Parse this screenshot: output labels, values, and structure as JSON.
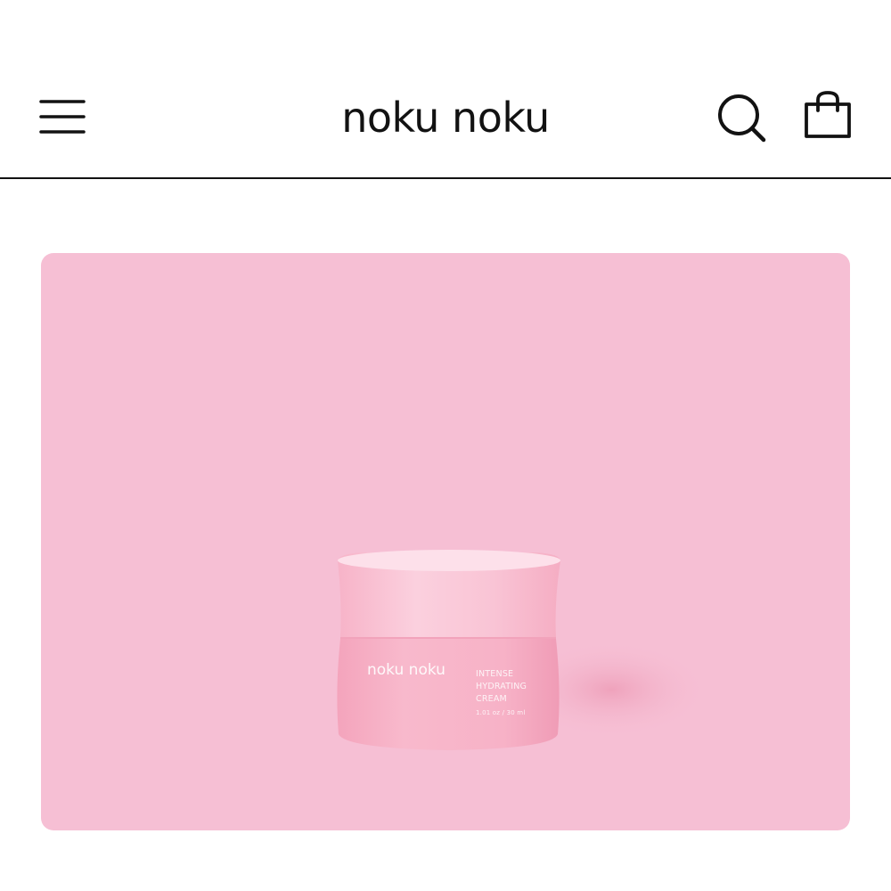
{
  "header": {
    "brand": "noku noku",
    "menu_icon": "hamburger-menu-icon",
    "search_icon": "search-icon",
    "cart_icon": "shopping-bag-icon"
  },
  "hero": {
    "background_color": "#f6bfd4",
    "product": {
      "brand_label": "noku noku",
      "name_lines": [
        "INTENSE",
        "HYDRATING",
        "CREAM"
      ],
      "size": "1.01 oz / 30 ml"
    }
  },
  "colors": {
    "text": "#121212",
    "hero_bg": "#f6bfd4",
    "jar": "#f8b9cc"
  }
}
